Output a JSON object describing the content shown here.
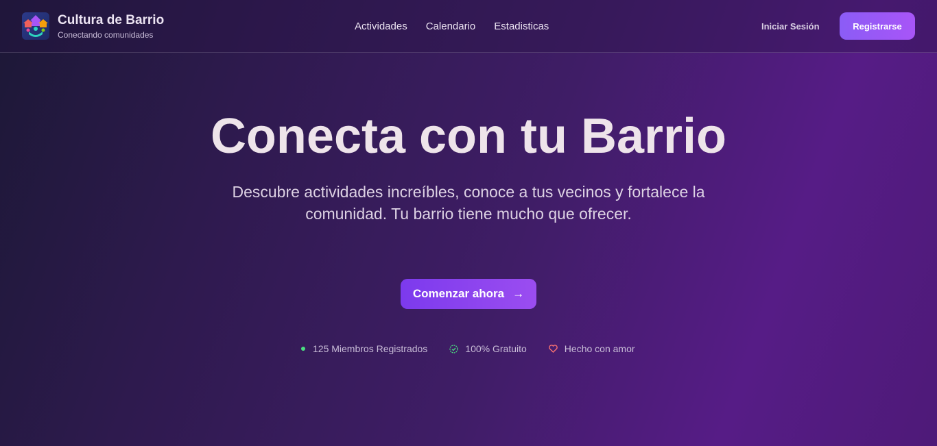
{
  "header": {
    "brand_title": "Cultura de Barrio",
    "brand_subtitle": "Conectando comunidades",
    "nav": [
      "Actividades",
      "Calendario",
      "Estadisticas"
    ],
    "login_label": "Iniciar Sesión",
    "register_label": "Registrarse"
  },
  "hero": {
    "title": "Conecta con tu Barrio",
    "subtitle": "Descubre actividades increíbles, conoce a tus vecinos y fortalece la comunidad. Tu barrio tiene mucho que ofrecer.",
    "cta_label": "Comenzar ahora",
    "cta_icon": "arrow-right-icon"
  },
  "stats": [
    {
      "label": "125 Miembros Registrados",
      "icon": "green-dot-icon"
    },
    {
      "label": "100% Gratuito",
      "icon": "check-circle-icon"
    },
    {
      "label": "Hecho con amor",
      "icon": "heart-icon"
    }
  ],
  "colors": {
    "accent": "#8b5cf6",
    "green": "#4ade80",
    "heart": "#f87171"
  }
}
